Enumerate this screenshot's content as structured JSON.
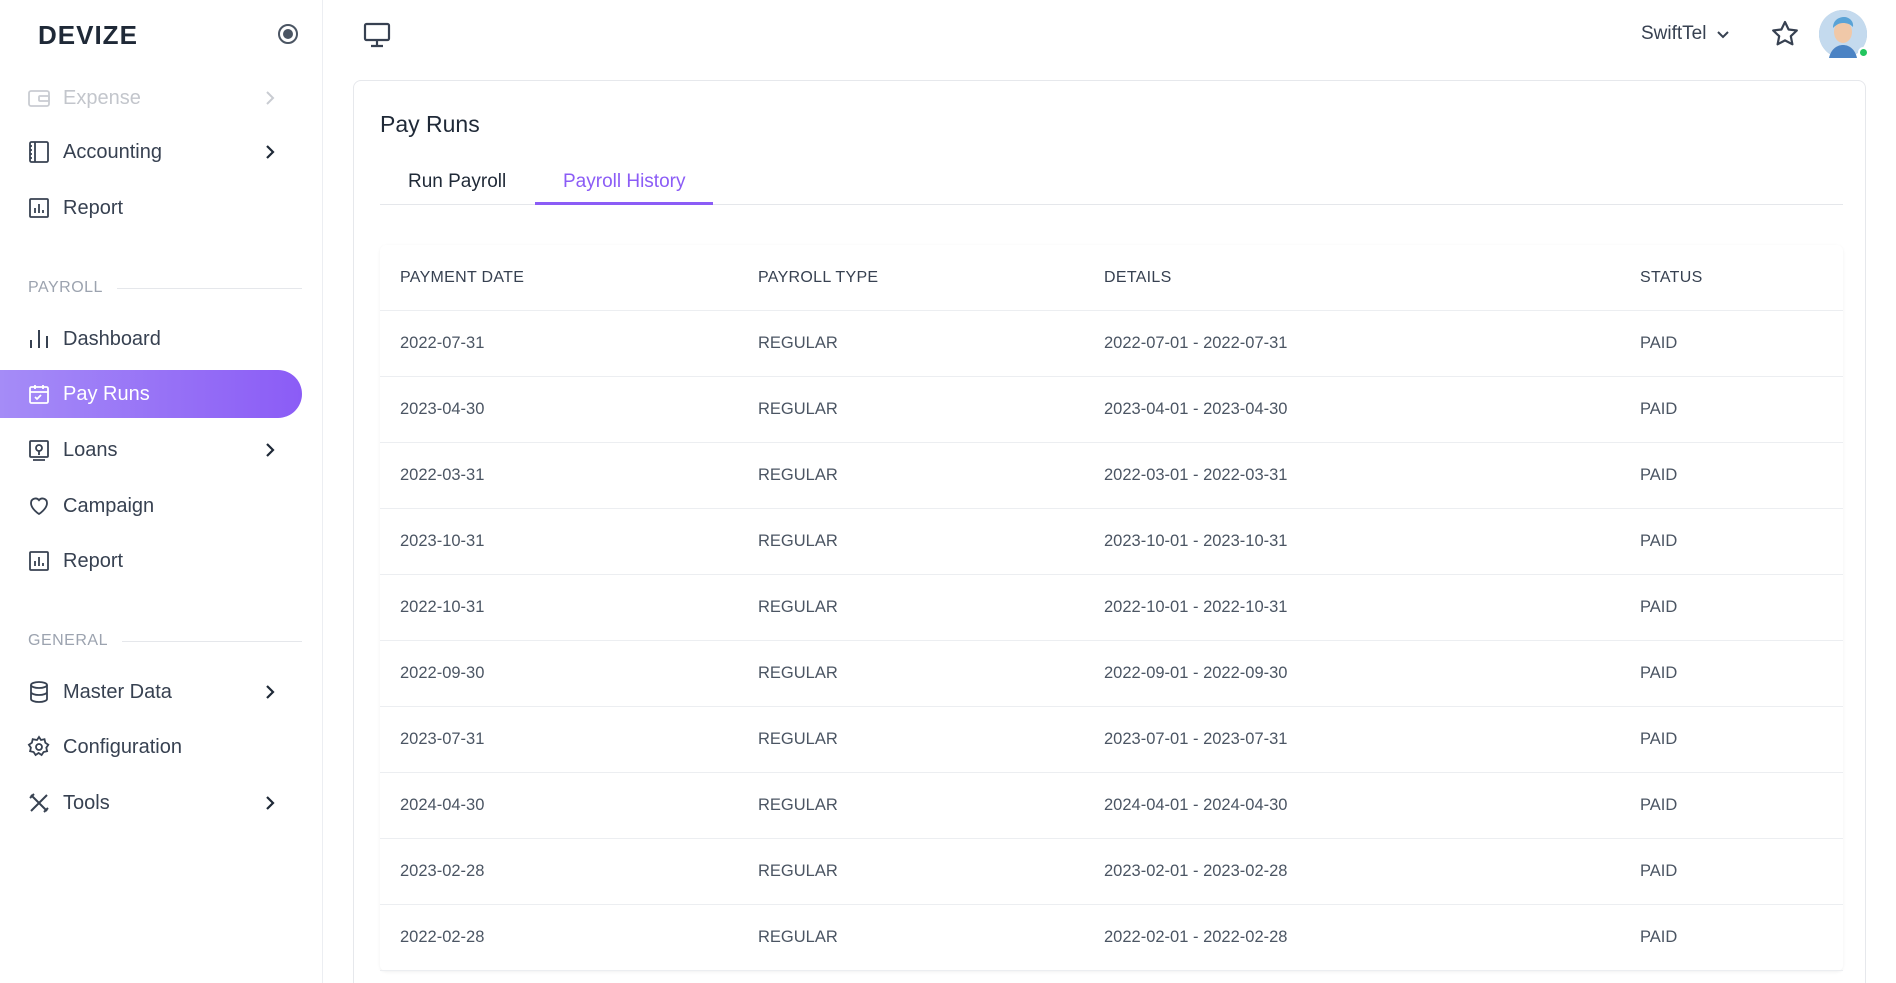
{
  "brand": "DEVIZE",
  "sidebar": {
    "items_top": [
      {
        "label": "Expense",
        "icon": "wallet-icon",
        "chevron": true,
        "faded": true
      },
      {
        "label": "Accounting",
        "icon": "book-icon",
        "chevron": true
      },
      {
        "label": "Report",
        "icon": "bar-chart-icon",
        "chevron": false
      }
    ],
    "section_payroll": "PAYROLL",
    "payroll_items": [
      {
        "label": "Dashboard",
        "icon": "bars-icon",
        "chevron": false
      },
      {
        "label": "Pay Runs",
        "icon": "calendar-icon",
        "chevron": false,
        "active": true
      },
      {
        "label": "Loans",
        "icon": "loan-icon",
        "chevron": true
      },
      {
        "label": "Campaign",
        "icon": "heart-icon",
        "chevron": false
      },
      {
        "label": "Report",
        "icon": "bar-chart-icon",
        "chevron": false
      }
    ],
    "section_general": "GENERAL",
    "general_items": [
      {
        "label": "Master Data",
        "icon": "database-icon",
        "chevron": true
      },
      {
        "label": "Configuration",
        "icon": "gear-icon",
        "chevron": false
      },
      {
        "label": "Tools",
        "icon": "tools-icon",
        "chevron": true
      }
    ]
  },
  "topbar": {
    "company": "SwiftTel"
  },
  "page": {
    "title": "Pay Runs",
    "tabs": [
      "Run Payroll",
      "Payroll History"
    ],
    "active_tab": "Payroll History"
  },
  "table": {
    "headers": [
      "PAYMENT DATE",
      "PAYROLL TYPE",
      "DETAILS",
      "STATUS"
    ],
    "rows": [
      [
        "2022-07-31",
        "REGULAR",
        "2022-07-01 - 2022-07-31",
        "PAID"
      ],
      [
        "2023-04-30",
        "REGULAR",
        "2023-04-01 - 2023-04-30",
        "PAID"
      ],
      [
        "2022-03-31",
        "REGULAR",
        "2022-03-01 - 2022-03-31",
        "PAID"
      ],
      [
        "2023-10-31",
        "REGULAR",
        "2023-10-01 - 2023-10-31",
        "PAID"
      ],
      [
        "2022-10-31",
        "REGULAR",
        "2022-10-01 - 2022-10-31",
        "PAID"
      ],
      [
        "2022-09-30",
        "REGULAR",
        "2022-09-01 - 2022-09-30",
        "PAID"
      ],
      [
        "2023-07-31",
        "REGULAR",
        "2023-07-01 - 2023-07-31",
        "PAID"
      ],
      [
        "2024-04-30",
        "REGULAR",
        "2024-04-01 - 2024-04-30",
        "PAID"
      ],
      [
        "2023-02-28",
        "REGULAR",
        "2023-02-01 - 2023-02-28",
        "PAID"
      ],
      [
        "2022-02-28",
        "REGULAR",
        "2022-02-01 - 2022-02-28",
        "PAID"
      ]
    ]
  },
  "colors": {
    "accent": "#8b5cf6",
    "accent_light": "#a58cf7",
    "online": "#22c55e"
  }
}
